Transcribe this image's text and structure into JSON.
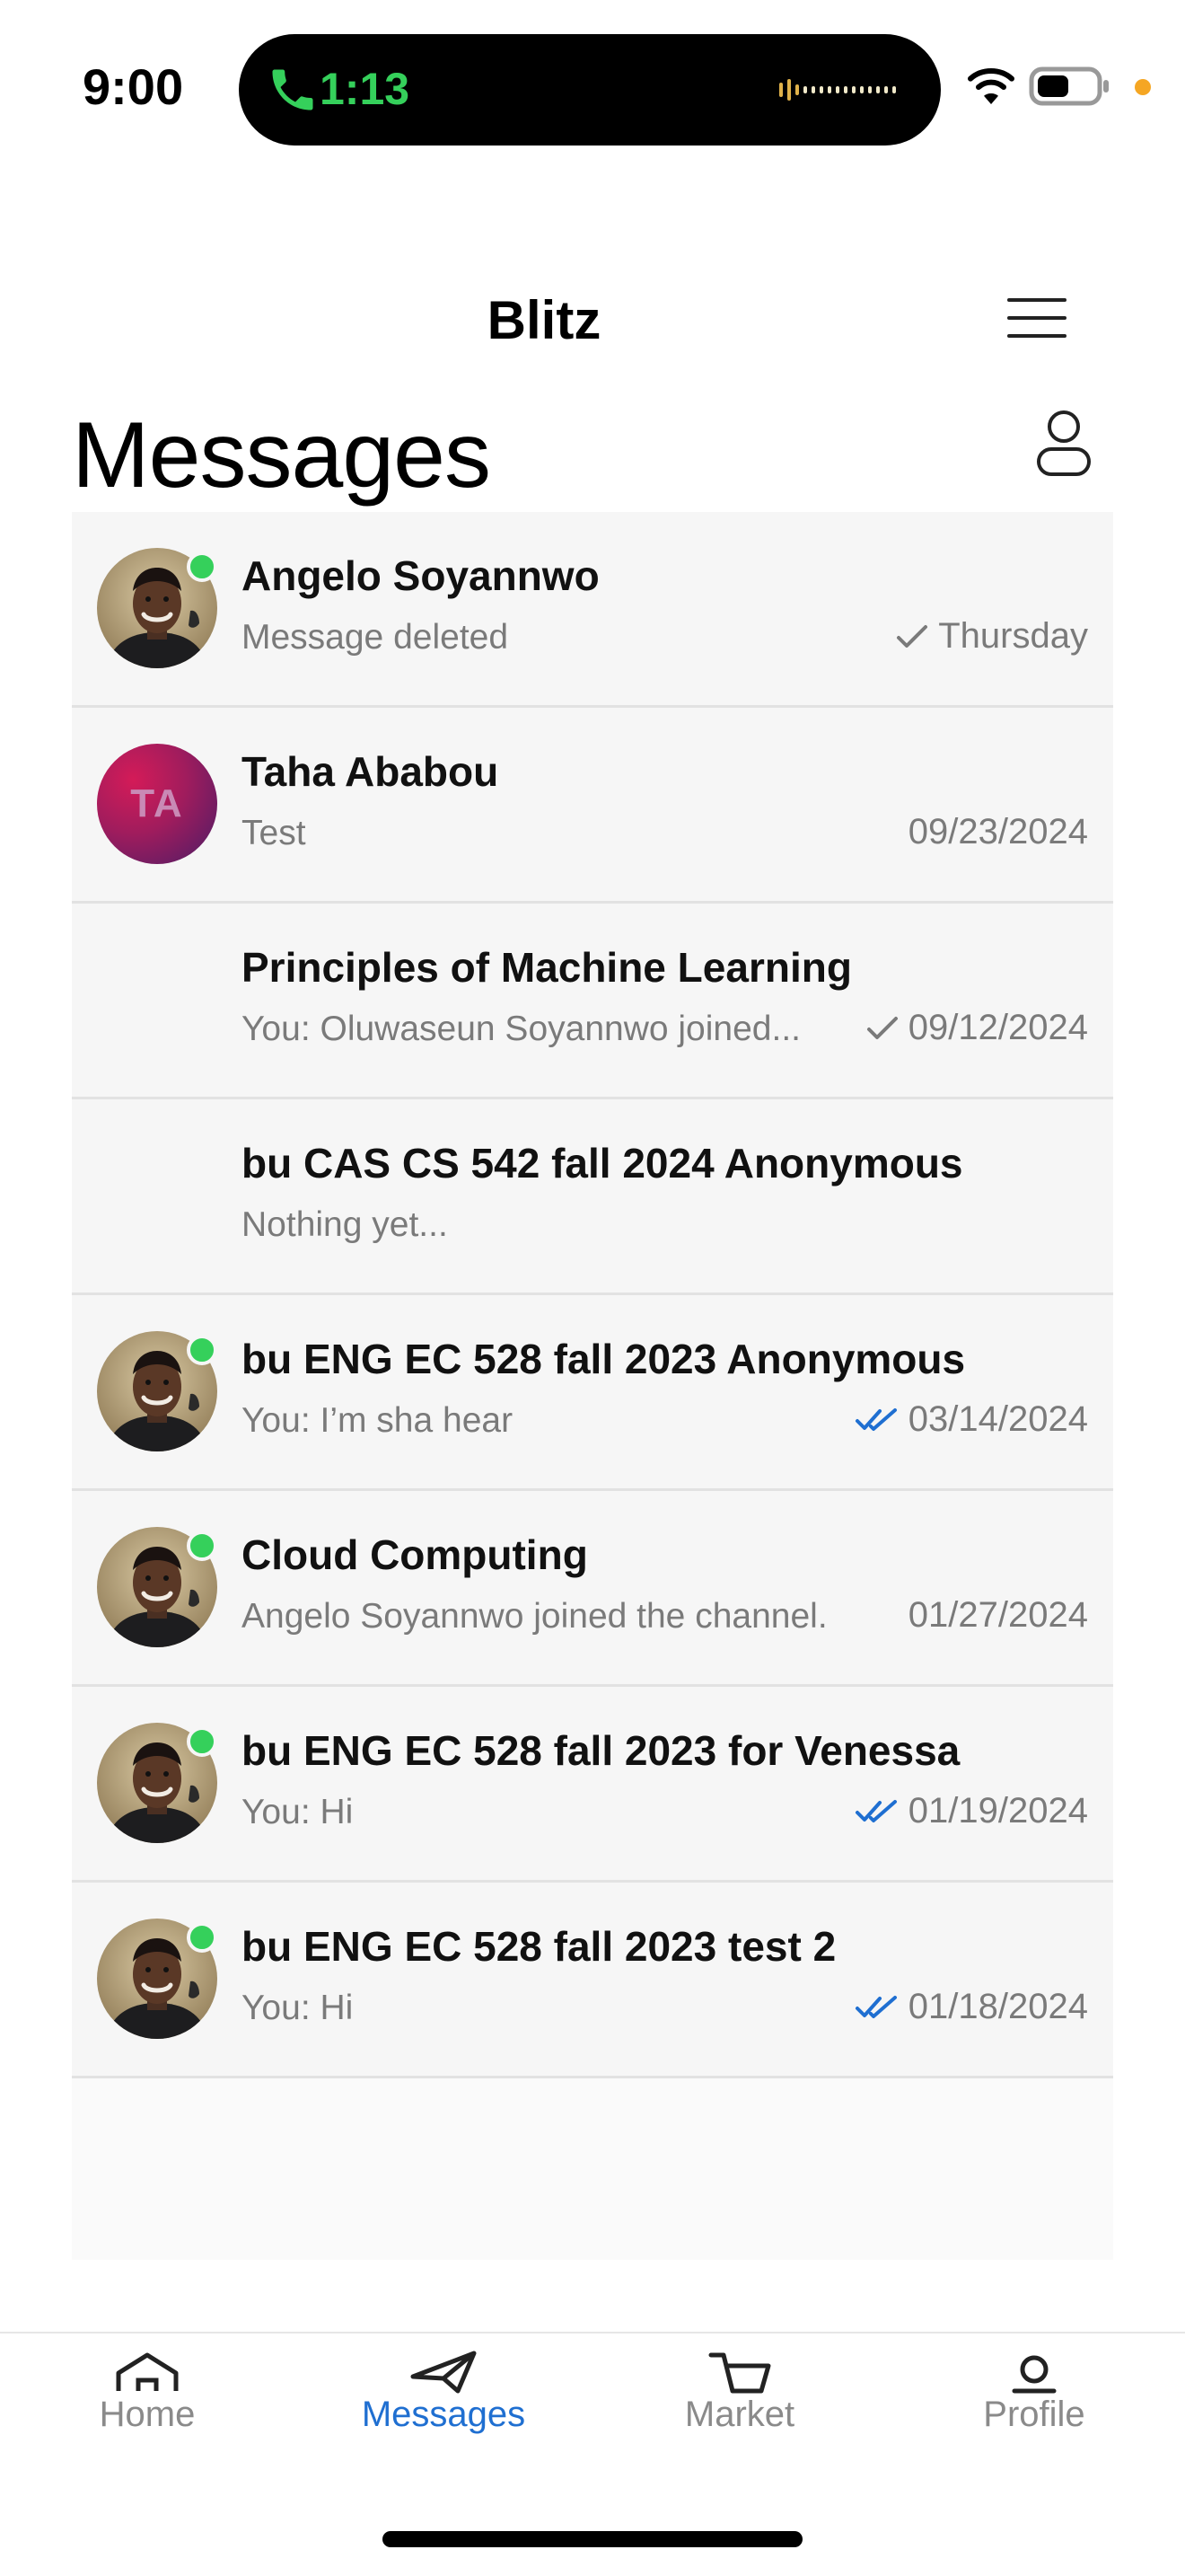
{
  "status_bar": {
    "time": "9:00",
    "call_duration": "1:13",
    "accent_green": "#35d05b",
    "indicator_orange": "#f5a623"
  },
  "header": {
    "app_title": "Blitz",
    "menu_icon": "hamburger-menu-icon",
    "page_title": "Messages",
    "account_icon": "person-icon"
  },
  "conversations": [
    {
      "name": "Angelo Soyannwo",
      "preview": "Message deleted",
      "date": "Thursday",
      "receipt": "sent",
      "avatar": "photo",
      "online": true
    },
    {
      "name": "Taha Ababou",
      "preview": "Test",
      "date": "09/23/2024",
      "receipt": "none",
      "avatar": "initials",
      "initials": "TA",
      "online": false
    },
    {
      "name": "Principles of Machine Learning",
      "preview": "You: Oluwaseun Soyannwo joined...",
      "date": "09/12/2024",
      "receipt": "sent",
      "avatar": "none",
      "online": false
    },
    {
      "name": "bu CAS CS 542 fall 2024 Anonymous",
      "preview": "Nothing yet...",
      "date": "",
      "receipt": "none",
      "avatar": "none",
      "online": false
    },
    {
      "name": "bu ENG EC 528 fall 2023 Anonymous",
      "preview": "You: I’m sha hear",
      "date": "03/14/2024",
      "receipt": "read",
      "avatar": "photo",
      "online": true
    },
    {
      "name": "Cloud Computing",
      "preview": "Angelo Soyannwo joined the channel.",
      "date": "01/27/2024",
      "receipt": "none",
      "avatar": "photo",
      "online": true
    },
    {
      "name": "bu ENG EC 528 fall 2023 for Venessa",
      "preview": "You: Hi",
      "date": "01/19/2024",
      "receipt": "read",
      "avatar": "photo",
      "online": true
    },
    {
      "name": "bu ENG EC 528 fall 2023 test 2",
      "preview": "You: Hi",
      "date": "01/18/2024",
      "receipt": "read",
      "avatar": "photo",
      "online": true
    }
  ],
  "tab_bar": {
    "tabs": [
      {
        "label": "Home",
        "icon": "home-icon",
        "active": false
      },
      {
        "label": "Messages",
        "icon": "paper-plane-icon",
        "active": true
      },
      {
        "label": "Market",
        "icon": "cart-icon",
        "active": false
      },
      {
        "label": "Profile",
        "icon": "profile-icon",
        "active": false
      }
    ],
    "active_color": "#1f6fd1",
    "inactive_color": "#8a8a8a"
  }
}
